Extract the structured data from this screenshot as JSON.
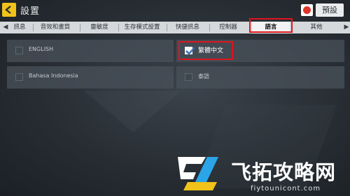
{
  "header": {
    "title": "設置",
    "preset_label": "預設"
  },
  "tabs": [
    {
      "label": "訊息",
      "active": false
    },
    {
      "label": "音效和畫質",
      "active": false
    },
    {
      "label": "靈敏度",
      "active": false
    },
    {
      "label": "生存模式設置",
      "active": false
    },
    {
      "label": "快捷訊息",
      "active": false
    },
    {
      "label": "控制器",
      "active": false
    },
    {
      "label": "語言",
      "active": true
    },
    {
      "label": "其他",
      "active": false
    }
  ],
  "languages": [
    {
      "label": "ENGLISH",
      "checked": false
    },
    {
      "label": "繁體中文",
      "checked": true
    },
    {
      "label": "Bahasa Indonesia",
      "checked": false
    },
    {
      "label": "泰語",
      "checked": false
    }
  ],
  "watermark": {
    "text": "飞拓攻略网",
    "url": "fiytounicont.com"
  },
  "colors": {
    "highlight": "#e0141e",
    "accent": "#f0c21a",
    "brand": "#e0352b"
  }
}
